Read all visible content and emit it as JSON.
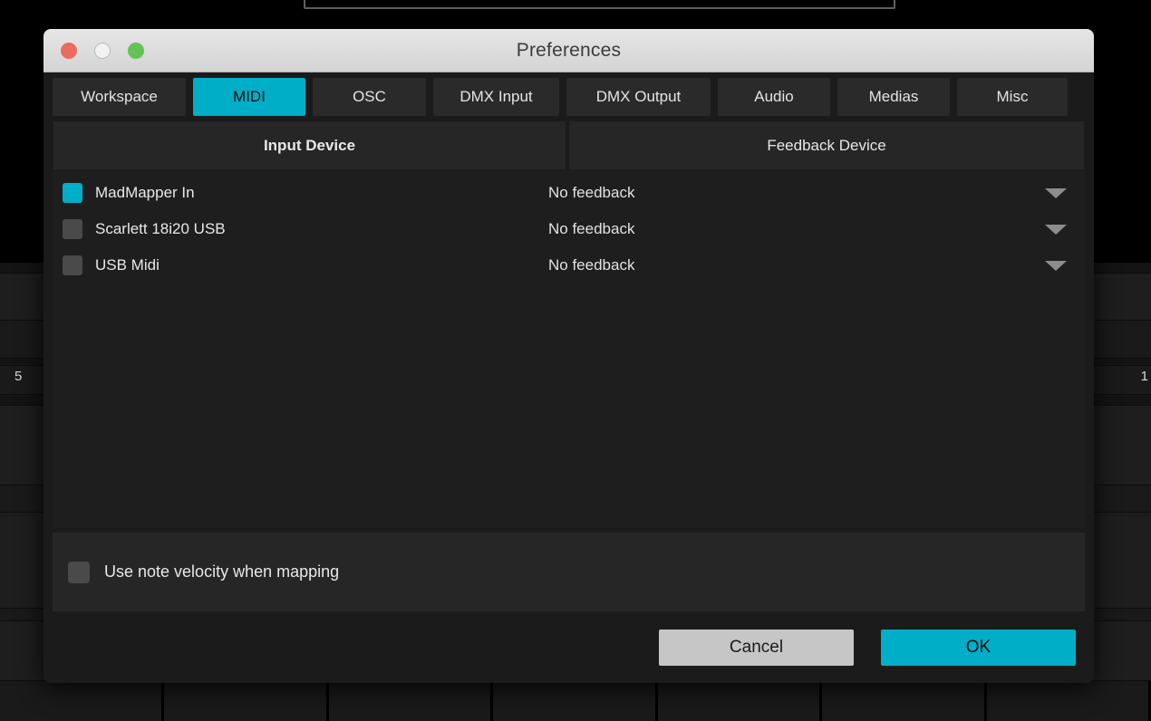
{
  "window": {
    "title": "Preferences",
    "traffic_lights": [
      "close-button",
      "minimize-button",
      "zoom-button"
    ]
  },
  "accent_color": "#00aec7",
  "tabs": [
    {
      "label": "Workspace",
      "active": false
    },
    {
      "label": "MIDI",
      "active": true
    },
    {
      "label": "OSC",
      "active": false
    },
    {
      "label": "DMX Input",
      "active": false
    },
    {
      "label": "DMX Output",
      "active": false
    },
    {
      "label": "Audio",
      "active": false
    },
    {
      "label": "Medias",
      "active": false
    },
    {
      "label": "Misc",
      "active": false
    }
  ],
  "table": {
    "headers": {
      "input_device": "Input Device",
      "feedback_device": "Feedback Device"
    },
    "rows": [
      {
        "checked": true,
        "input_device": "MadMapper In",
        "feedback_device": "No feedback"
      },
      {
        "checked": false,
        "input_device": "Scarlett 18i20 USB",
        "feedback_device": "No feedback"
      },
      {
        "checked": false,
        "input_device": "USB Midi",
        "feedback_device": "No feedback"
      }
    ]
  },
  "options": {
    "use_note_velocity": {
      "label": "Use note velocity when mapping",
      "checked": false
    }
  },
  "footer": {
    "cancel_label": "Cancel",
    "ok_label": "OK"
  },
  "background": {
    "left_number": "5",
    "right_number": "1"
  }
}
